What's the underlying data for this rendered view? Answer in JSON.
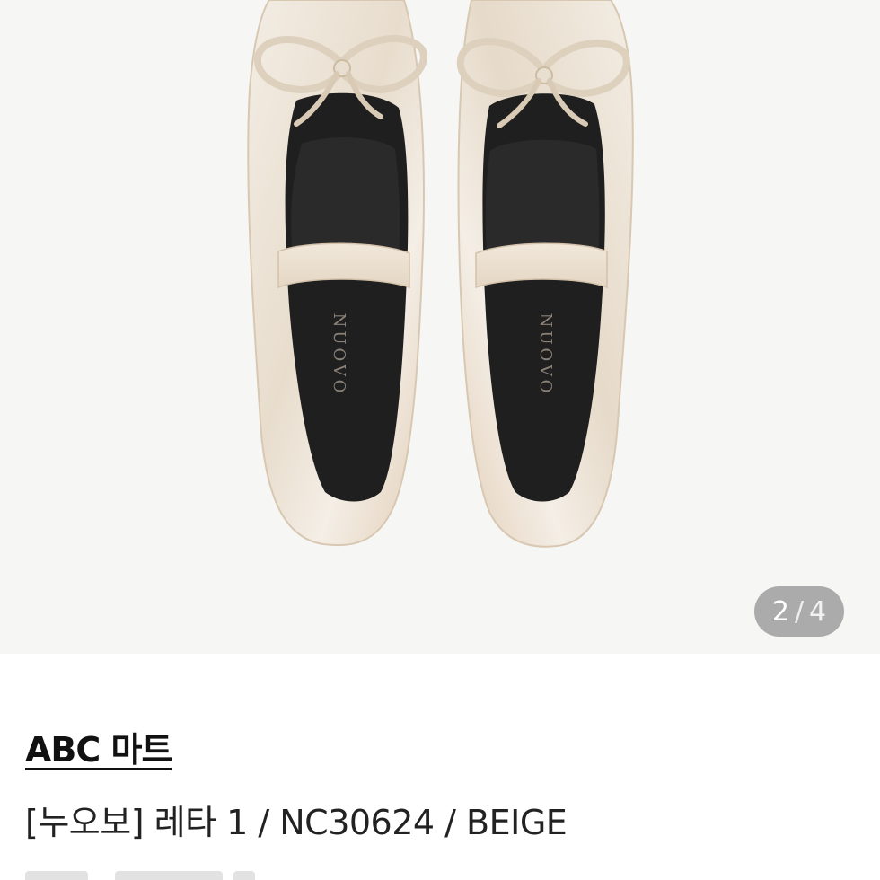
{
  "product_image": {
    "alt": "NUOVO beige satin ballet flats with bow",
    "brand_mark": "NUOVO",
    "counter": {
      "current": "2",
      "separator": "/",
      "total": "4"
    }
  },
  "store": {
    "name": "ABC 마트"
  },
  "product": {
    "title": "[누오보] 레타 1 / NC30624 / BEIGE"
  },
  "colors": {
    "image_bg": "#f6f6f5",
    "shoe_satin": "#ece3d6",
    "insole": "#1e1e1e",
    "counter_bg": "#969696"
  }
}
